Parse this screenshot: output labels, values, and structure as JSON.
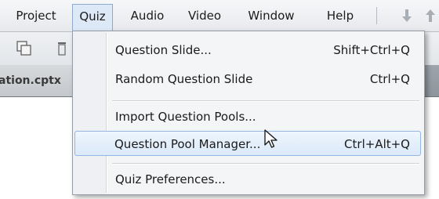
{
  "menubar": {
    "items": [
      "Project",
      "Quiz",
      "Audio",
      "Video",
      "Window",
      "Help"
    ],
    "active_index": 1
  },
  "toolbar": {
    "icons": [
      "copy-icon",
      "delete-icon"
    ]
  },
  "document": {
    "tab_label": "ation.cptx"
  },
  "quiz_menu": {
    "items": [
      {
        "label": "Question Slide...",
        "shortcut": "Shift+Ctrl+Q"
      },
      {
        "label": "Random Question Slide",
        "shortcut": "Ctrl+Q"
      },
      {
        "label": "Import Question Pools...",
        "shortcut": ""
      },
      {
        "label": "Question Pool Manager...",
        "shortcut": "Ctrl+Alt+Q"
      },
      {
        "label": "Quiz Preferences...",
        "shortcut": ""
      }
    ],
    "highlighted_index": 3
  },
  "colors": {
    "highlight_border": "#93b6e2",
    "highlight_fill": "#dbe9f9",
    "active_menu_fill": "#dde9f7"
  }
}
